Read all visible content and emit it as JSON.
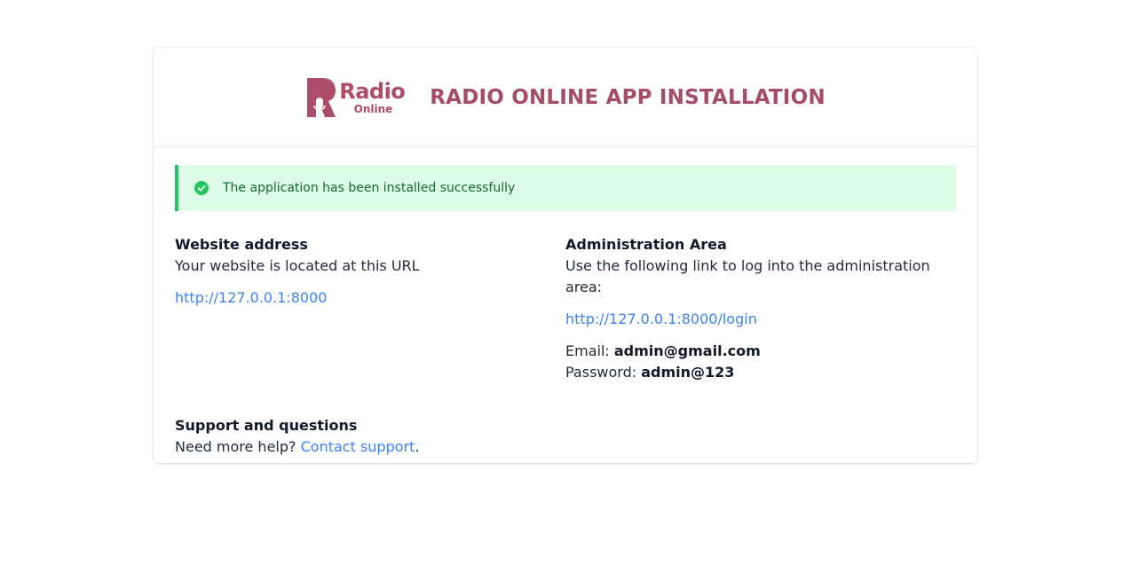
{
  "header": {
    "logo": {
      "word": "Radio",
      "sub": "Online",
      "icon": "microphone-logo-icon"
    },
    "title": "RADIO ONLINE APP INSTALLATION"
  },
  "alert": {
    "icon": "check-circle-icon",
    "message": "The application has been installed successfully"
  },
  "website": {
    "title": "Website address",
    "description": "Your website is located at this URL",
    "url": "http://127.0.0.1:8000"
  },
  "admin": {
    "title": "Administration Area",
    "description": "Use the following link to log into the administration area:",
    "url": "http://127.0.0.1:8000/login",
    "email_label": "Email:",
    "email_value": "admin@gmail.com",
    "password_label": "Password:",
    "password_value": "admin@123"
  },
  "support": {
    "title": "Support and questions",
    "text_before": "Need more help?",
    "link_text": "Contact support",
    "text_after": "."
  },
  "colors": {
    "brand": "#a64d66",
    "success_bg": "#dcfce7",
    "success_border": "#22c55e",
    "success_text": "#166534",
    "link": "#3b82f6"
  }
}
